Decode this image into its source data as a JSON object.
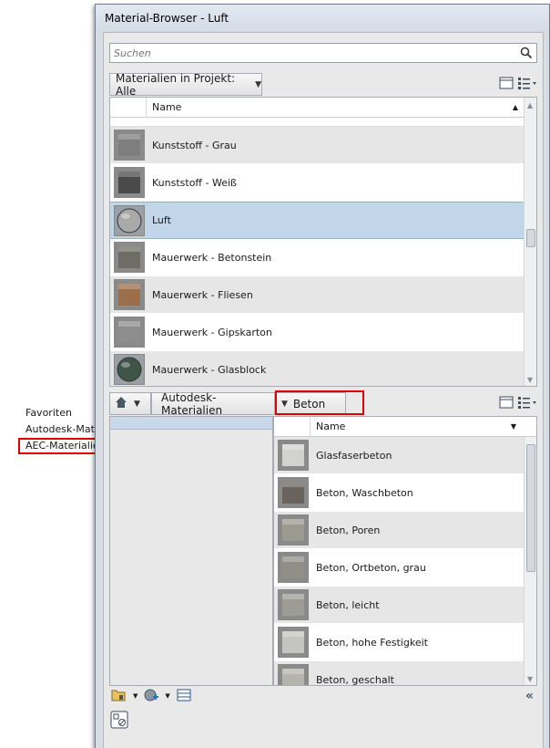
{
  "window": {
    "title": "Material-Browser - Luft"
  },
  "search": {
    "placeholder": "Suchen",
    "icon": "search-icon"
  },
  "project_bar": {
    "filter_label": "Materialien in Projekt: Alle"
  },
  "project_list": {
    "column_header": "Name",
    "rows": [
      {
        "label": "Kunststoff - Grau",
        "selected": false,
        "swatch": "#7e7e7e"
      },
      {
        "label": "Kunststoff - Weiß",
        "selected": false,
        "swatch": "#4a4a4a"
      },
      {
        "label": "Luft",
        "selected": true,
        "swatch": "#a9a9a9"
      },
      {
        "label": "Mauerwerk - Betonstein",
        "selected": false,
        "swatch": "#6d6d66"
      },
      {
        "label": "Mauerwerk - Fliesen",
        "selected": false,
        "swatch": "#9c6e4a"
      },
      {
        "label": "Mauerwerk - Gipskarton",
        "selected": false,
        "swatch": "#8d8d8d"
      },
      {
        "label": "Mauerwerk - Glasblock",
        "selected": false,
        "swatch": "#3e5547"
      }
    ]
  },
  "library_bar": {
    "breadcrumb_library": "Autodesk-Materialien",
    "breadcrumb_category": "Beton"
  },
  "library_list": {
    "column_header": "Name",
    "rows": [
      {
        "label": "Glasfaserbeton",
        "swatch": "#d2d2d0"
      },
      {
        "label": "Beton, Waschbeton",
        "swatch": "#6a625c"
      },
      {
        "label": "Beton, Poren",
        "swatch": "#9a9a90"
      },
      {
        "label": "Beton, Ortbeton, grau",
        "swatch": "#8f8f88"
      },
      {
        "label": "Beton, leicht",
        "swatch": "#9d9d95"
      },
      {
        "label": "Beton, hohe Festigkeit",
        "swatch": "#c4c4c0"
      },
      {
        "label": "Beton, geschalt",
        "swatch": "#b4b4ad"
      }
    ]
  },
  "library_menu": {
    "items": [
      "Favoriten",
      "Autodesk-Materialien",
      "AEC-Materialien"
    ],
    "highlighted": "AEC-Materialien"
  },
  "colors": {
    "selection": "#c2d6ea",
    "highlight_box": "#e00000"
  }
}
